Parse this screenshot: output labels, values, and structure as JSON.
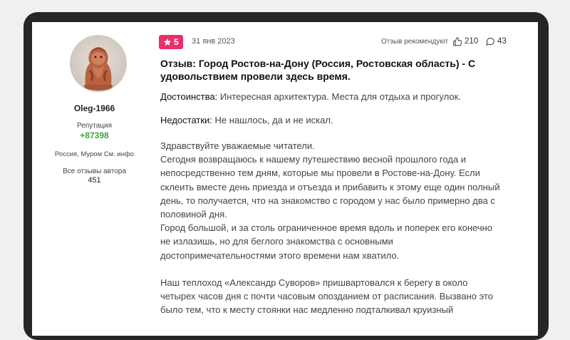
{
  "author": {
    "name": "Oleg-1966",
    "reputation_label": "Репутация",
    "reputation_value": "+87398",
    "location": "Россия, Муром См. инфо",
    "all_reviews_label": "Все отзывы автора",
    "all_reviews_count": "451"
  },
  "review": {
    "rating": "5",
    "date": "31 янв 2023",
    "recommend_label": "Отзыв рекомендуют",
    "likes": "210",
    "comments": "43",
    "title": "Отзыв: Город Ростов-на-Дону (Россия, Ростовская область) - С удовольствием провели здесь время.",
    "pros_label": "Достоинства:",
    "pros_text": "Интересная архитектура. Места для отдыха и прогулок.",
    "cons_label": "Недостатки:",
    "cons_text": "Не нашлось, да и не искал.",
    "paragraphs": [
      "Здравствуйте уважаемые читатели.",
      "Сегодня возвращаюсь к нашему путешествию весной прошлого года и непосредственно тем дням, которые мы провели в Ростове-на-Дону. Если склеить вместе день приезда и отъезда и прибавить к этому еще один полный день, то получается, что на знакомство с городом у нас было примерно два с половиной дня.",
      "Город большой, и за столь ограниченное время вдоль и поперек его конечно не излазишь, но для беглого знакомства с основными достопримечательностями этого времени нам хватило.",
      "Наш теплоход «Александр Суворов» пришвартовался к берегу в около четырех часов дня с почти часовым опозданием от расписания. Вызвано это было тем, что к месту стоянки нас медленно подталкивал круизный"
    ]
  },
  "colors": {
    "rating_bg": "#e8306b",
    "reputation": "#3ca83c",
    "device_frame": "#262626",
    "page_bg": "#eef0f2"
  },
  "icons": [
    "star-icon",
    "thumbs-up-icon",
    "comment-icon"
  ]
}
